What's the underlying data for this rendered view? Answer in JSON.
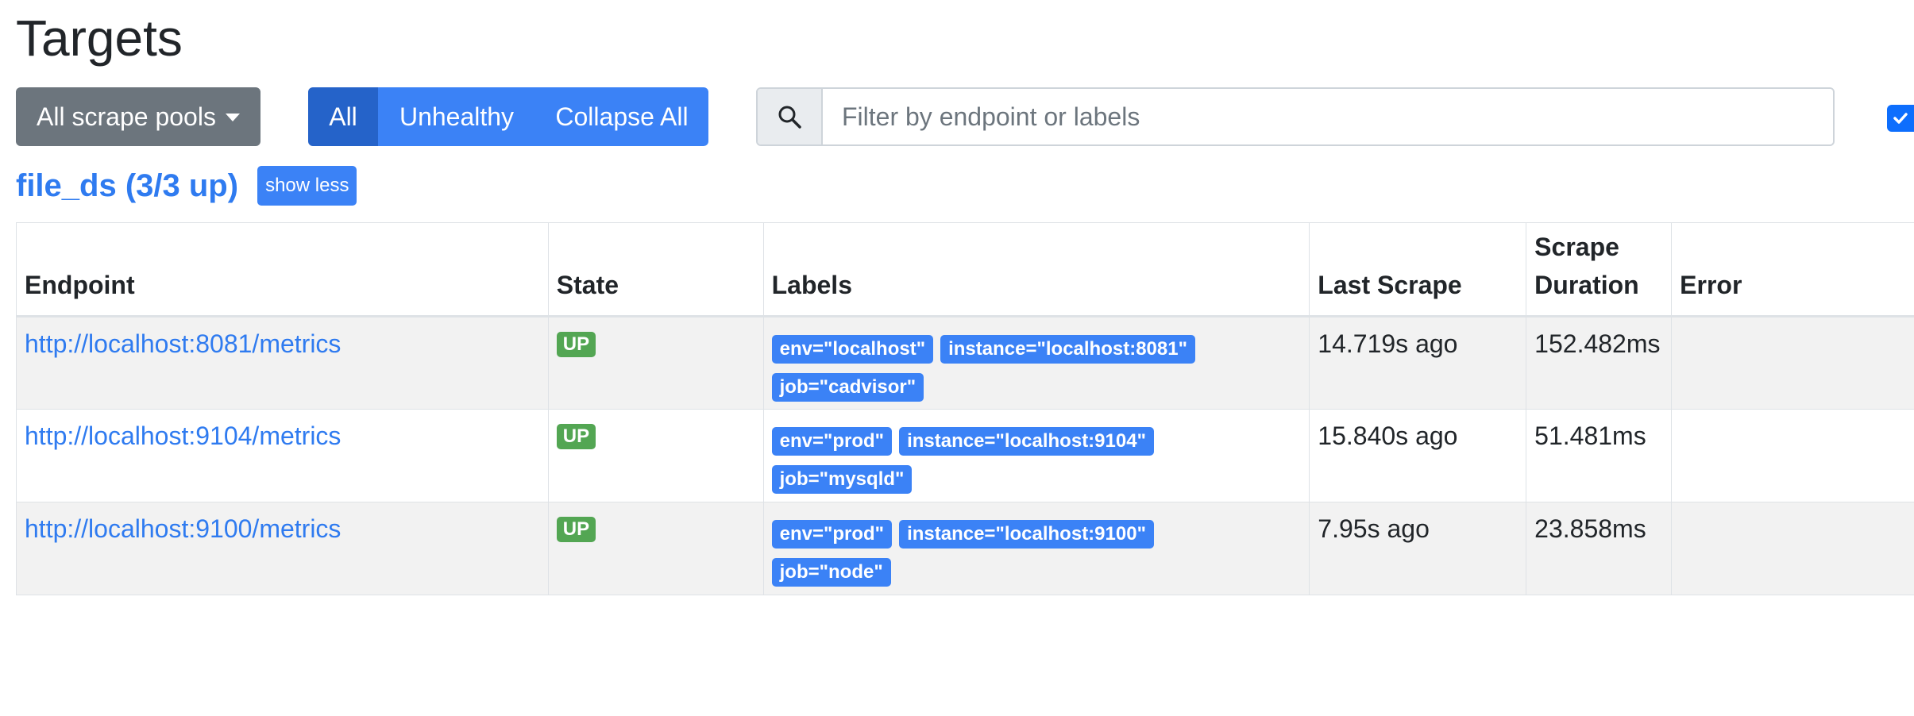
{
  "page": {
    "title": "Targets"
  },
  "toolbar": {
    "pools_label": "All scrape pools",
    "filters": [
      {
        "label": "All",
        "active": true
      },
      {
        "label": "Unhealthy",
        "active": false
      },
      {
        "label": "Collapse All",
        "active": false
      }
    ],
    "search_placeholder": "Filter by endpoint or labels",
    "search_value": "",
    "checkbox_checked": true
  },
  "pool": {
    "title": "file_ds (3/3 up)",
    "toggle_label": "show less"
  },
  "table": {
    "headers": {
      "endpoint": "Endpoint",
      "state": "State",
      "labels": "Labels",
      "last_scrape": "Last Scrape",
      "scrape_duration": "Scrape Duration",
      "error": "Error"
    },
    "rows": [
      {
        "endpoint": "http://localhost:8081/metrics",
        "state": "UP",
        "labels": [
          "env=\"localhost\"",
          "instance=\"localhost:8081\"",
          "job=\"cadvisor\""
        ],
        "last_scrape": "14.719s ago",
        "scrape_duration": "152.482ms",
        "error": ""
      },
      {
        "endpoint": "http://localhost:9104/metrics",
        "state": "UP",
        "labels": [
          "env=\"prod\"",
          "instance=\"localhost:9104\"",
          "job=\"mysqld\""
        ],
        "last_scrape": "15.840s ago",
        "scrape_duration": "51.481ms",
        "error": ""
      },
      {
        "endpoint": "http://localhost:9100/metrics",
        "state": "UP",
        "labels": [
          "env=\"prod\"",
          "instance=\"localhost:9100\"",
          "job=\"node\""
        ],
        "last_scrape": "7.95s ago",
        "scrape_duration": "23.858ms",
        "error": ""
      }
    ]
  },
  "colors": {
    "primary": "#3b82f6",
    "primary_active": "#2563c9",
    "secondary": "#6c757d",
    "success": "#53a653",
    "link": "#2f7bf0"
  }
}
